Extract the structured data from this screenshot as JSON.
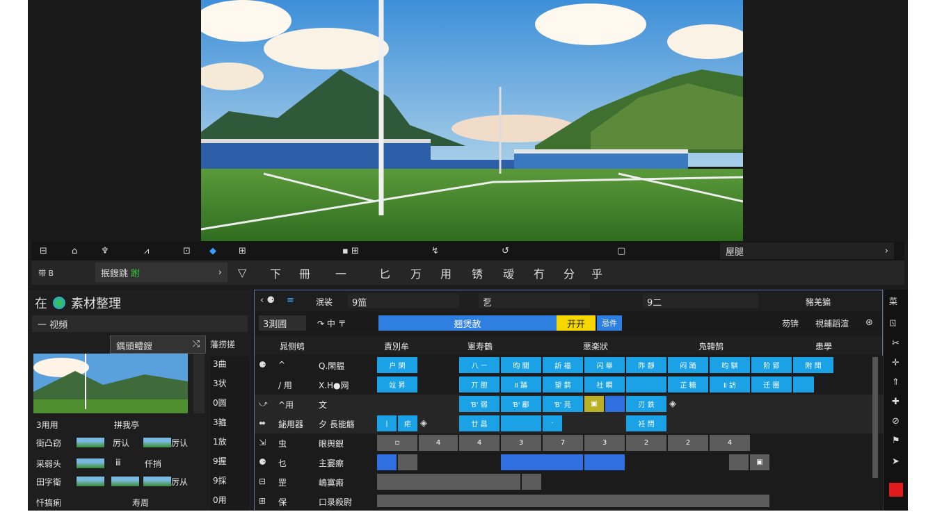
{
  "toolbar1": {
    "icons": [
      "menu-icon",
      "home-icon",
      "pin-icon",
      "user-icon",
      "camera-icon",
      "chat-icon",
      "save-icon",
      "grid-icon",
      "layout-icon",
      "split-icon",
      "clock-icon",
      "window-icon"
    ],
    "right_label": "屋腿"
  },
  "toolbar2": {
    "left_label": "带 B",
    "dropdown_label": "抿鎪跳",
    "dropdown_status": "跗",
    "tools": [
      "▽",
      "下",
      "冊",
      "一",
      "匕",
      "万",
      "用",
      "锈",
      "叆",
      "冇",
      "分",
      "乎"
    ]
  },
  "left_panel": {
    "title": "在",
    "title_rest": "素材整理",
    "filter": "一  视頻",
    "tab": "鍝頭鳢鎪",
    "tab_close": "⤭",
    "header_right": "藩捞搓",
    "rows": [
      {
        "a": "3用用",
        "b": "拼我亭"
      },
      {
        "a": "街凸窃",
        "b": "厉认",
        "c": "厉认"
      },
      {
        "a": "采弱头",
        "b": "ⅲ",
        "c": "仟捎"
      },
      {
        "a": "田字衛",
        "b": "厉从"
      },
      {
        "a": "忏搞痢",
        "b": "寿周"
      }
    ],
    "side_labels": [
      "3曲",
      "3状",
      "0圆",
      "3箍",
      "1放",
      "9握",
      "9採",
      "0用"
    ]
  },
  "timeline": {
    "toolbar": {
      "left": "泯裟",
      "field1": "9笽",
      "field2": "乭",
      "field3": "9二",
      "right": "豬羌猵"
    },
    "bar2": {
      "left": "3測圃",
      "icons": "↷ 中 〒",
      "blue_label": "翘煲赦",
      "yellow_label": "开开",
      "small_label": "忌件",
      "right1": "芴锛",
      "right2": "視鋪蹈渲"
    },
    "columns": [
      "晁侧鸲",
      "責別牟",
      "憲寿鶴",
      "悪楽狀",
      "凫韓鹄",
      "患學"
    ],
    "rows": [
      {
        "c1": "^",
        "c2": "Q.閑腽"
      },
      {
        "c1": "/ 用",
        "c2": "X.H●网"
      },
      {
        "c1": "^用",
        "c2": "文"
      },
      {
        "c1": "鉍用器",
        "c2": "夕 長能觞"
      },
      {
        "c1": "虫",
        "c2": "眼舆銀"
      },
      {
        "c1": "乜",
        "c2": "主窭瘵"
      },
      {
        "c1": "罡",
        "c2": "嶋寞瘢"
      },
      {
        "c1": "保",
        "c2": "口录殺尉"
      }
    ],
    "gray_nums": [
      "4",
      "4",
      "3",
      "7",
      "3",
      "2",
      "2",
      "4"
    ]
  },
  "right_strip": {
    "top": "菜",
    "second": "ㄖ"
  }
}
